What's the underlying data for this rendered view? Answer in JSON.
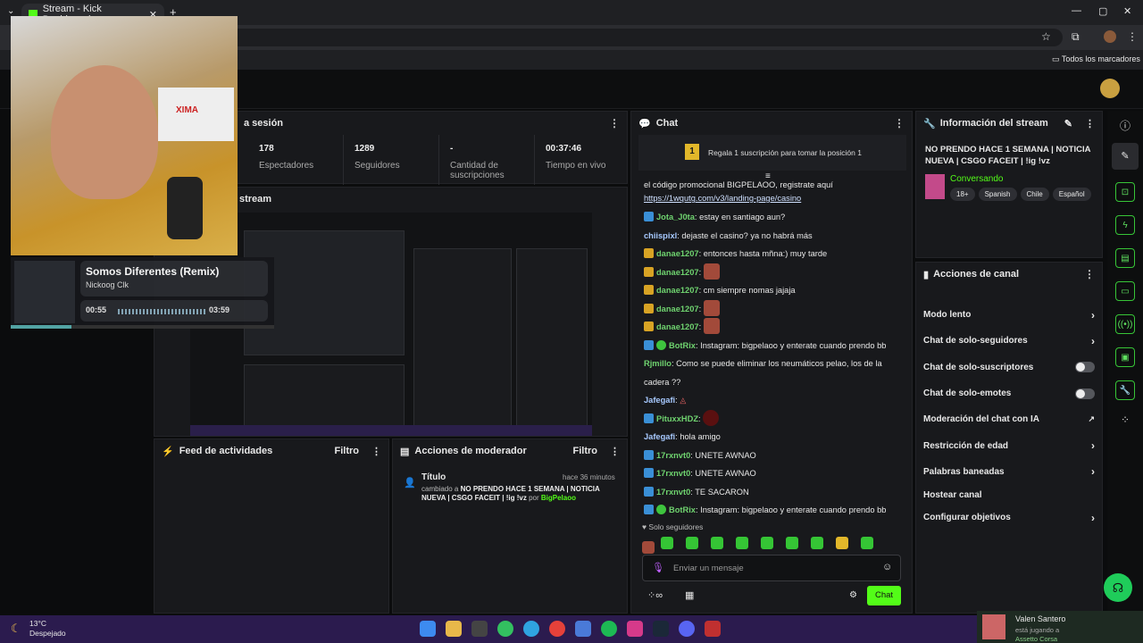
{
  "browser": {
    "tab_title": "Stream - Kick Dashboard",
    "bookmarks_label": "Todos los marcadores"
  },
  "overlay": {
    "music": {
      "title": "Somos Diferentes (Remix)",
      "artist": "Nickoog Clk",
      "elapsed": "00:55",
      "total": "03:59",
      "progress": 0.23
    },
    "sponsor_text": "XIMA"
  },
  "session": {
    "title": "a sesión",
    "stats": [
      {
        "value": "178",
        "label": "Espectadores"
      },
      {
        "value": "1289",
        "label": "Seguidores"
      },
      {
        "value": "-",
        "label": "Cantidad de suscripciones"
      },
      {
        "value": "00:37:46",
        "label": "Tiempo en vivo"
      }
    ]
  },
  "preview": {
    "title": "stream"
  },
  "feed": {
    "title": "Feed de actividades",
    "filter": "Filtro"
  },
  "modactions": {
    "title": "Acciones de moderador",
    "filter": "Filtro",
    "entry": {
      "heading": "Título",
      "time": "hace 36 minutos",
      "prefix": "cambiado a",
      "text": "NO PRENDO HACE 1 SEMANA | NOTICIA NUEVA | CSGO FACEIT | !ig !vz",
      "by": "por",
      "user": "BigPelaoo"
    }
  },
  "chat": {
    "title": "Chat",
    "gift_text": "Regala 1 suscripción para tomar la posición 1",
    "gift_pos": "1",
    "promo_text": "el código promocional BIGPELAOO, registrate aquí",
    "promo_link": "https://1wqutg.com/v3/landing-page/casino",
    "messages": [
      {
        "user": "Jota_J0ta",
        "text": "estay en santiago aun?"
      },
      {
        "user": "chiispixl",
        "text": "dejaste el casino? ya no habrá más"
      },
      {
        "user": "danae1207",
        "text": "entonces hasta mñna:) muy tarde"
      },
      {
        "user": "danae1207",
        "text": ""
      },
      {
        "user": "danae1207",
        "text": "cm siempre nomas jajaja"
      },
      {
        "user": "danae1207",
        "text": ""
      },
      {
        "user": "danae1207",
        "text": ""
      },
      {
        "user": "BotRix",
        "text": "Instagram: bigpelaoo y enterate cuando prendo bb"
      },
      {
        "user": "Rjmillo",
        "text": "Como se puede eliminar los neumáticos pelao, los de la"
      },
      {
        "user": "",
        "text": "cadera ??"
      },
      {
        "user": "Jafegafi",
        "text": ""
      },
      {
        "user": "PituxxHDZ",
        "text": ""
      },
      {
        "user": "Jafegafi",
        "text": "hola amigo"
      },
      {
        "user": "17rxnvt0",
        "text": "UNETE AWNAO"
      },
      {
        "user": "17rxnvt0",
        "text": "UNETE AWNAO"
      },
      {
        "user": "17rxnvt0",
        "text": "TE SACARON"
      },
      {
        "user": "BotRix",
        "text": "Instagram: bigpelaoo y enterate cuando prendo bb"
      }
    ],
    "followers_only": "Solo seguidores",
    "input_placeholder": "Enviar un mensaje",
    "send_label": "Chat"
  },
  "streaminfo": {
    "title": "Información del stream",
    "stream_title": "NO PRENDO HACE 1 SEMANA | NOTICIA NUEVA | CSGO FACEIT | !ig !vz",
    "category": "Conversando",
    "tags": [
      "18+",
      "Spanish",
      "Chile",
      "Español"
    ]
  },
  "channelactions": {
    "title": "Acciones de canal",
    "items": [
      "Modo lento",
      "Chat de solo-seguidores",
      "Chat de solo-suscriptores",
      "Chat de solo-emotes",
      "Moderación del chat con IA",
      "Restricción de edad",
      "Palabras baneadas",
      "Hostear canal",
      "Configurar objetivos"
    ]
  },
  "taskbar": {
    "temp": "13°C",
    "weather": "Despejado"
  },
  "notif": {
    "name": "Valen Santero",
    "status": "está jugando a",
    "game": "Assetto Corsa"
  },
  "colors": {
    "accent": "#53fc18",
    "panel": "#18191c",
    "taskbar": "#3b2266"
  }
}
